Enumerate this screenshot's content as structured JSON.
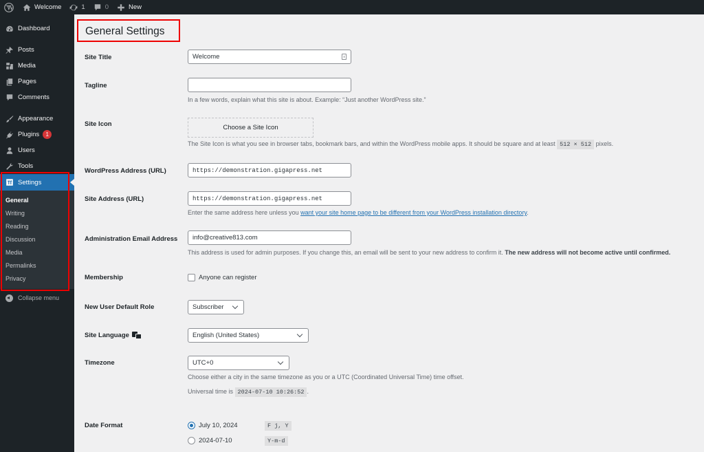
{
  "adminbar": {
    "site_name": "Welcome",
    "updates_count": "1",
    "comments_count": "0",
    "new_label": "New"
  },
  "sidebar": {
    "items": [
      {
        "label": "Dashboard",
        "icon": "dashboard-icon"
      },
      {
        "label": "Posts",
        "icon": "pin-icon"
      },
      {
        "label": "Media",
        "icon": "media-icon"
      },
      {
        "label": "Pages",
        "icon": "pages-icon"
      },
      {
        "label": "Comments",
        "icon": "comment-icon"
      },
      {
        "label": "Appearance",
        "icon": "paintbrush-icon"
      },
      {
        "label": "Plugins",
        "icon": "plugin-icon",
        "badge": "1"
      },
      {
        "label": "Users",
        "icon": "user-icon"
      },
      {
        "label": "Tools",
        "icon": "wrench-icon"
      },
      {
        "label": "Settings",
        "icon": "settings-icon"
      }
    ],
    "submenu": [
      "General",
      "Writing",
      "Reading",
      "Discussion",
      "Media",
      "Permalinks",
      "Privacy"
    ],
    "collapse_label": "Collapse menu"
  },
  "page": {
    "title": "General Settings"
  },
  "form": {
    "site_title": {
      "label": "Site Title",
      "value": "Welcome"
    },
    "tagline": {
      "label": "Tagline",
      "value": "",
      "description": "In a few words, explain what this site is about. Example: “Just another WordPress site.”"
    },
    "site_icon": {
      "label": "Site Icon",
      "button": "Choose a Site Icon",
      "description_pre": "The Site Icon is what you see in browser tabs, bookmark bars, and within the WordPress mobile apps. It should be square and at least",
      "size_code": "512 × 512",
      "description_post": "pixels."
    },
    "wp_address": {
      "label": "WordPress Address (URL)",
      "value": "https://demonstration.gigapress.net"
    },
    "site_address": {
      "label": "Site Address (URL)",
      "value": "https://demonstration.gigapress.net",
      "description_pre": "Enter the same address here unless you",
      "link_text": "want your site home page to be different from your WordPress installation directory",
      "description_post": "."
    },
    "admin_email": {
      "label": "Administration Email Address",
      "value": "info@creative813.com",
      "description_pre": "This address is used for admin purposes. If you change this, an email will be sent to your new address to confirm it.",
      "description_bold": "The new address will not become active until confirmed."
    },
    "membership": {
      "label": "Membership",
      "checkbox_label": "Anyone can register",
      "checked": false
    },
    "default_role": {
      "label": "New User Default Role",
      "value": "Subscriber"
    },
    "site_language": {
      "label": "Site Language",
      "value": "English (United States)"
    },
    "timezone": {
      "label": "Timezone",
      "value": "UTC+0",
      "description": "Choose either a city in the same timezone as you or a UTC (Coordinated Universal Time) time offset.",
      "universal_pre": "Universal time is",
      "universal_time": "2024-07-10 10:26:52",
      "universal_post": "."
    },
    "date_format": {
      "label": "Date Format",
      "options": [
        {
          "label": "July 10, 2024",
          "code": "F j, Y",
          "checked": true
        },
        {
          "label": "2024-07-10",
          "code": "Y-m-d",
          "checked": false
        }
      ]
    }
  },
  "colors": {
    "accent": "#2271b1",
    "adminbar_bg": "#1d2327",
    "highlight_box": "#e00000",
    "badge": "#d63638"
  }
}
